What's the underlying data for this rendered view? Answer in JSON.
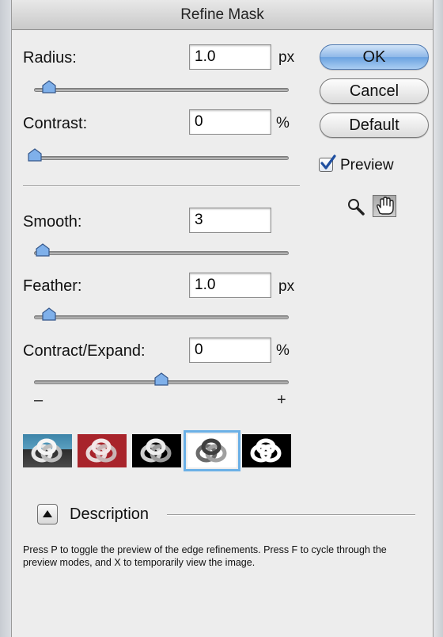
{
  "window": {
    "title": "Refine Mask"
  },
  "radius": {
    "label": "Radius:",
    "value": "1.0",
    "unit": "px",
    "slider_fraction": 0.09
  },
  "contrast": {
    "label": "Contrast:",
    "value": "0",
    "unit": "%",
    "slider_fraction": 0.0
  },
  "smooth": {
    "label": "Smooth:",
    "value": "3",
    "slider_fraction": 0.03
  },
  "feather": {
    "label": "Feather:",
    "value": "1.0",
    "unit": "px",
    "slider_fraction": 0.09
  },
  "contract_expand": {
    "label": "Contract/Expand:",
    "value": "0",
    "unit": "%",
    "slider_fraction": 0.5,
    "minus_label": "–",
    "plus_label": "+"
  },
  "buttons": {
    "ok": "OK",
    "cancel": "Cancel",
    "default": "Default"
  },
  "preview": {
    "label": "Preview",
    "checked": true
  },
  "tools": [
    {
      "name": "zoom-tool",
      "icon": "magnifier-icon",
      "active": false
    },
    {
      "name": "hand-tool",
      "icon": "hand-icon",
      "active": true
    }
  ],
  "preview_modes": [
    {
      "name": "mode-standard",
      "selected": false
    },
    {
      "name": "mode-quick-mask",
      "selected": false
    },
    {
      "name": "mode-on-black",
      "selected": false
    },
    {
      "name": "mode-on-white",
      "selected": true
    },
    {
      "name": "mode-mask",
      "selected": false
    }
  ],
  "description": {
    "heading": "Description",
    "text": "Press P to toggle the preview of the edge refinements. Press F to cycle through the preview modes, and X to temporarily view the image."
  },
  "colors": {
    "default_button": "#6aa2e0",
    "selection_ring": "#6bb0e6",
    "checkmark": "#1f4fa0"
  }
}
